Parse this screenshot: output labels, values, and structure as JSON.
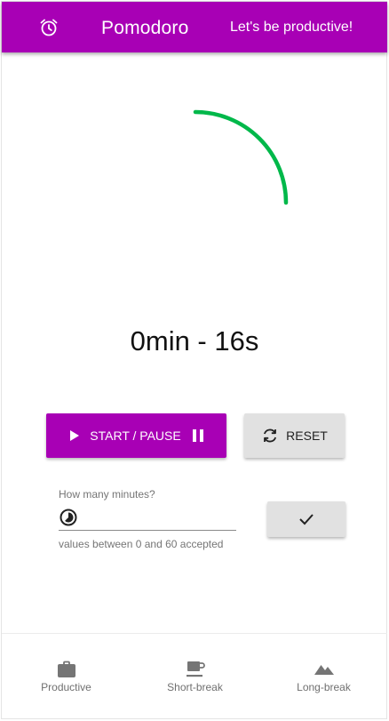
{
  "appbar": {
    "title": "Pomodoro",
    "tagline": "Let's be productive!",
    "icon": "alarm-clock-icon"
  },
  "timer": {
    "display": "0min - 16s",
    "progress_fraction": 0.25,
    "progress_color": "#00b84a"
  },
  "controls": {
    "start_pause_label": "START / PAUSE",
    "reset_label": "RESET"
  },
  "minutes_field": {
    "label": "How many minutes?",
    "value": "",
    "helper_text": "values between 0 and 60 accepted",
    "icon": "timelapse-icon"
  },
  "bottom_nav": {
    "items": [
      {
        "label": "Productive",
        "icon": "briefcase-icon"
      },
      {
        "label": "Short-break",
        "icon": "coffee-icon"
      },
      {
        "label": "Long-break",
        "icon": "mountains-icon"
      }
    ]
  },
  "colors": {
    "primary": "#a800b5",
    "button_grey": "#e1e1e1"
  }
}
